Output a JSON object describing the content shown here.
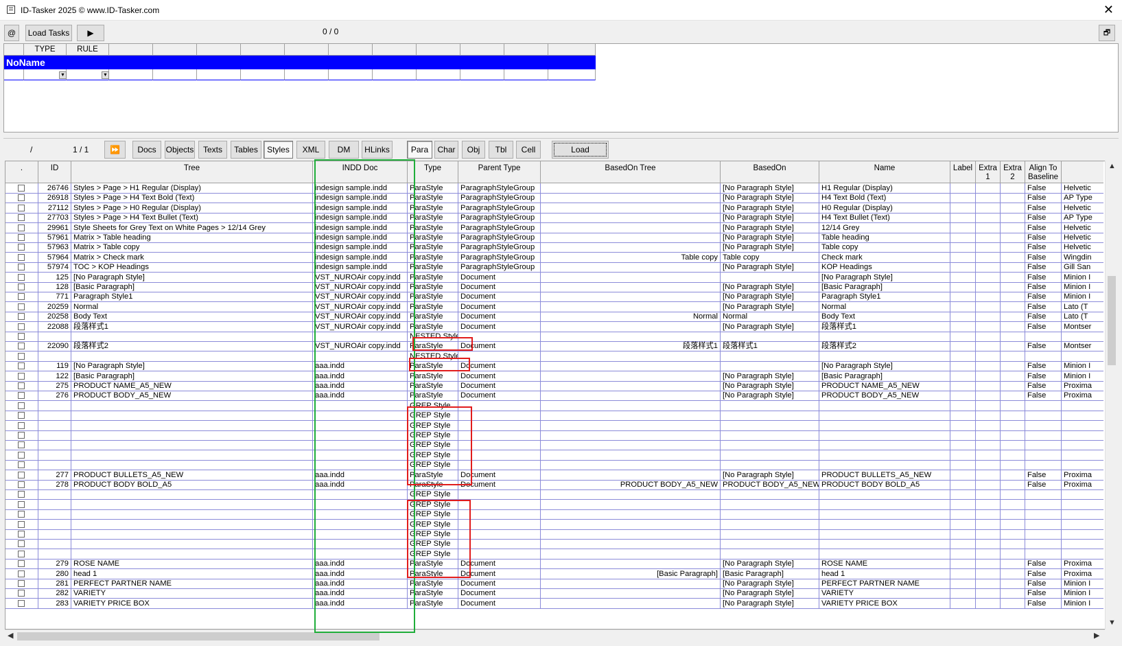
{
  "window": {
    "title": "ID-Tasker 2025  © www.ID-Tasker.com"
  },
  "toolbar": {
    "at_label": "@",
    "load_tasks_label": "Load Tasks",
    "counter": "0 / 0"
  },
  "rules": {
    "columns": [
      "",
      "TYPE",
      "RULE",
      "",
      "",
      "",
      "",
      "",
      "",
      "",
      "",
      "",
      ""
    ],
    "group_name": "NoName"
  },
  "nav": {
    "slash": "/",
    "page": "1 / 1",
    "tabs": [
      "Docs",
      "Objects",
      "Texts",
      "Tables",
      "Styles",
      "XML",
      "DM",
      "HLinks"
    ],
    "active_tab": "Styles",
    "subtabs": [
      "Para",
      "Char",
      "Obj",
      "Tbl",
      "Cell"
    ],
    "active_subtab": "Para",
    "load_label": "Load"
  },
  "grid": {
    "columns": [
      ".",
      "ID",
      "Tree",
      "INDD Doc",
      "Type",
      "Parent Type",
      "BasedOn Tree",
      "BasedOn",
      "Name",
      "Label",
      "Extra 1",
      "Extra 2",
      "Align To Baseline",
      ""
    ],
    "rows": [
      [
        "26746",
        "Styles > Page > H1 Regular (Display)",
        "indesign sample.indd",
        "ParaStyle",
        "ParagraphStyleGroup",
        "",
        "[No Paragraph Style]",
        "H1 Regular (Display)",
        "",
        "",
        "",
        "False",
        "Helvetic"
      ],
      [
        "26918",
        "Styles > Page > H4 Text Bold (Text)",
        "indesign sample.indd",
        "ParaStyle",
        "ParagraphStyleGroup",
        "",
        "[No Paragraph Style]",
        "H4 Text Bold (Text)",
        "",
        "",
        "",
        "False",
        "AP Type"
      ],
      [
        "27112",
        "Styles > Page > H0 Regular (Display)",
        "indesign sample.indd",
        "ParaStyle",
        "ParagraphStyleGroup",
        "",
        "[No Paragraph Style]",
        "H0 Regular (Display)",
        "",
        "",
        "",
        "False",
        "Helvetic"
      ],
      [
        "27703",
        "Styles > Page > H4 Text Bullet (Text)",
        "indesign sample.indd",
        "ParaStyle",
        "ParagraphStyleGroup",
        "",
        "[No Paragraph Style]",
        "H4 Text Bullet (Text)",
        "",
        "",
        "",
        "False",
        "AP Type"
      ],
      [
        "29961",
        "Style Sheets for Grey Text on White Pages > 12/14 Grey",
        "indesign sample.indd",
        "ParaStyle",
        "ParagraphStyleGroup",
        "",
        "[No Paragraph Style]",
        "12/14 Grey",
        "",
        "",
        "",
        "False",
        "Helvetic"
      ],
      [
        "57961",
        "Matrix > Table heading",
        "indesign sample.indd",
        "ParaStyle",
        "ParagraphStyleGroup",
        "",
        "[No Paragraph Style]",
        "Table heading",
        "",
        "",
        "",
        "False",
        "Helvetic"
      ],
      [
        "57963",
        "Matrix > Table copy",
        "indesign sample.indd",
        "ParaStyle",
        "ParagraphStyleGroup",
        "",
        "[No Paragraph Style]",
        "Table copy",
        "",
        "",
        "",
        "False",
        "Helvetic"
      ],
      [
        "57964",
        "Matrix > Check mark",
        "indesign sample.indd",
        "ParaStyle",
        "ParagraphStyleGroup",
        "Table copy",
        "Table copy",
        "Check mark",
        "",
        "",
        "",
        "False",
        "Wingdin"
      ],
      [
        "57974",
        "TOC > KOP Headings",
        "indesign sample.indd",
        "ParaStyle",
        "ParagraphStyleGroup",
        "",
        "[No Paragraph Style]",
        "KOP Headings",
        "",
        "",
        "",
        "False",
        "Gill San"
      ],
      [
        "125",
        "[No Paragraph Style]",
        "VST_NUROAir copy.indd",
        "ParaStyle",
        "Document",
        "",
        "",
        "[No Paragraph Style]",
        "",
        "",
        "",
        "False",
        "Minion I"
      ],
      [
        "128",
        "[Basic Paragraph]",
        "VST_NUROAir copy.indd",
        "ParaStyle",
        "Document",
        "",
        "[No Paragraph Style]",
        "[Basic Paragraph]",
        "",
        "",
        "",
        "False",
        "Minion I"
      ],
      [
        "771",
        "Paragraph Style1",
        "VST_NUROAir copy.indd",
        "ParaStyle",
        "Document",
        "",
        "[No Paragraph Style]",
        "Paragraph Style1",
        "",
        "",
        "",
        "False",
        "Minion I"
      ],
      [
        "20259",
        "Normal",
        "VST_NUROAir copy.indd",
        "ParaStyle",
        "Document",
        "",
        "[No Paragraph Style]",
        "Normal",
        "",
        "",
        "",
        "False",
        "Lato (T"
      ],
      [
        "20258",
        "Body Text",
        "VST_NUROAir copy.indd",
        "ParaStyle",
        "Document",
        "Normal",
        "Normal",
        "Body Text",
        "",
        "",
        "",
        "False",
        "Lato (T"
      ],
      [
        "22088",
        "段落样式1",
        "VST_NUROAir copy.indd",
        "ParaStyle",
        "Document",
        "",
        "[No Paragraph Style]",
        "段落样式1",
        "",
        "",
        "",
        "False",
        "Montser"
      ],
      [
        "",
        "",
        "",
        "NESTED Style",
        "",
        "",
        "",
        "",
        "",
        "",
        "",
        "",
        ""
      ],
      [
        "22090",
        "段落样式2",
        "VST_NUROAir copy.indd",
        "ParaStyle",
        "Document",
        "段落样式1",
        "段落样式1",
        "段落样式2",
        "",
        "",
        "",
        "False",
        "Montser"
      ],
      [
        "",
        "",
        "",
        "NESTED Style",
        "",
        "",
        "",
        "",
        "",
        "",
        "",
        "",
        ""
      ],
      [
        "119",
        "[No Paragraph Style]",
        "aaa.indd",
        "ParaStyle",
        "Document",
        "",
        "",
        "[No Paragraph Style]",
        "",
        "",
        "",
        "False",
        "Minion I"
      ],
      [
        "122",
        "[Basic Paragraph]",
        "aaa.indd",
        "ParaStyle",
        "Document",
        "",
        "[No Paragraph Style]",
        "[Basic Paragraph]",
        "",
        "",
        "",
        "False",
        "Minion I"
      ],
      [
        "275",
        "PRODUCT NAME_A5_NEW",
        "aaa.indd",
        "ParaStyle",
        "Document",
        "",
        "[No Paragraph Style]",
        "PRODUCT NAME_A5_NEW",
        "",
        "",
        "",
        "False",
        "Proxima"
      ],
      [
        "276",
        "PRODUCT BODY_A5_NEW",
        "aaa.indd",
        "ParaStyle",
        "Document",
        "",
        "[No Paragraph Style]",
        "PRODUCT BODY_A5_NEW",
        "",
        "",
        "",
        "False",
        "Proxima"
      ],
      [
        "",
        "",
        "",
        "GREP Style",
        "",
        "",
        "",
        "",
        "",
        "",
        "",
        "",
        ""
      ],
      [
        "",
        "",
        "",
        "GREP Style",
        "",
        "",
        "",
        "",
        "",
        "",
        "",
        "",
        ""
      ],
      [
        "",
        "",
        "",
        "GREP Style",
        "",
        "",
        "",
        "",
        "",
        "",
        "",
        "",
        ""
      ],
      [
        "",
        "",
        "",
        "GREP Style",
        "",
        "",
        "",
        "",
        "",
        "",
        "",
        "",
        ""
      ],
      [
        "",
        "",
        "",
        "GREP Style",
        "",
        "",
        "",
        "",
        "",
        "",
        "",
        "",
        ""
      ],
      [
        "",
        "",
        "",
        "GREP Style",
        "",
        "",
        "",
        "",
        "",
        "",
        "",
        "",
        ""
      ],
      [
        "",
        "",
        "",
        "GREP Style",
        "",
        "",
        "",
        "",
        "",
        "",
        "",
        "",
        ""
      ],
      [
        "277",
        "PRODUCT BULLETS_A5_NEW",
        "aaa.indd",
        "ParaStyle",
        "Document",
        "",
        "[No Paragraph Style]",
        "PRODUCT BULLETS_A5_NEW",
        "",
        "",
        "",
        "False",
        "Proxima"
      ],
      [
        "278",
        "PRODUCT BODY BOLD_A5",
        "aaa.indd",
        "ParaStyle",
        "Document",
        "PRODUCT BODY_A5_NEW",
        "PRODUCT BODY_A5_NEW",
        "PRODUCT BODY BOLD_A5",
        "",
        "",
        "",
        "False",
        "Proxima"
      ],
      [
        "",
        "",
        "",
        "GREP Style",
        "",
        "",
        "",
        "",
        "",
        "",
        "",
        "",
        ""
      ],
      [
        "",
        "",
        "",
        "GREP Style",
        "",
        "",
        "",
        "",
        "",
        "",
        "",
        "",
        ""
      ],
      [
        "",
        "",
        "",
        "GREP Style",
        "",
        "",
        "",
        "",
        "",
        "",
        "",
        "",
        ""
      ],
      [
        "",
        "",
        "",
        "GREP Style",
        "",
        "",
        "",
        "",
        "",
        "",
        "",
        "",
        ""
      ],
      [
        "",
        "",
        "",
        "GREP Style",
        "",
        "",
        "",
        "",
        "",
        "",
        "",
        "",
        ""
      ],
      [
        "",
        "",
        "",
        "GREP Style",
        "",
        "",
        "",
        "",
        "",
        "",
        "",
        "",
        ""
      ],
      [
        "",
        "",
        "",
        "GREP Style",
        "",
        "",
        "",
        "",
        "",
        "",
        "",
        "",
        ""
      ],
      [
        "279",
        "ROSE NAME",
        "aaa.indd",
        "ParaStyle",
        "Document",
        "",
        "[No Paragraph Style]",
        "ROSE NAME",
        "",
        "",
        "",
        "False",
        "Proxima"
      ],
      [
        "280",
        "head 1",
        "aaa.indd",
        "ParaStyle",
        "Document",
        "[Basic Paragraph]",
        "[Basic Paragraph]",
        "head 1",
        "",
        "",
        "",
        "False",
        "Proxima"
      ],
      [
        "281",
        "PERFECT PARTNER NAME",
        "aaa.indd",
        "ParaStyle",
        "Document",
        "",
        "[No Paragraph Style]",
        "PERFECT PARTNER NAME",
        "",
        "",
        "",
        "False",
        "Minion I"
      ],
      [
        "282",
        "VARIETY",
        "aaa.indd",
        "ParaStyle",
        "Document",
        "",
        "[No Paragraph Style]",
        "VARIETY",
        "",
        "",
        "",
        "False",
        "Minion I"
      ],
      [
        "283",
        "VARIETY PRICE BOX",
        "aaa.indd",
        "ParaStyle",
        "Document",
        "",
        "[No Paragraph Style]",
        "VARIETY PRICE BOX",
        "",
        "",
        "",
        "False",
        "Minion I"
      ]
    ]
  },
  "colors": {
    "selection_blue": "#0000ff",
    "grid_lines": "#8b8bd9",
    "highlight_green": "#1fae3a",
    "highlight_red": "#e11c1c"
  }
}
